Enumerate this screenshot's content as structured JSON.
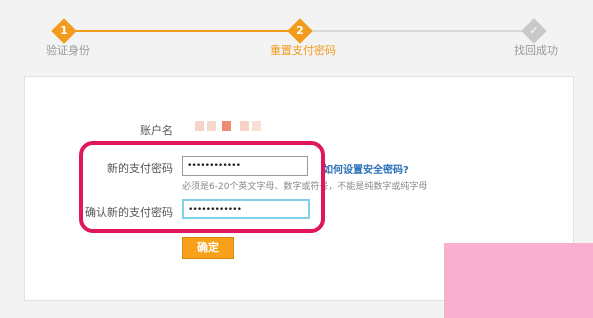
{
  "steps": [
    {
      "number": "1",
      "label": "验证身份",
      "state": "done"
    },
    {
      "number": "2",
      "label": "重置支付密码",
      "state": "active"
    },
    {
      "icon": "check-icon",
      "label": "找回成功",
      "state": "pending"
    }
  ],
  "form": {
    "account_label": "账户名",
    "new_password_label": "新的支付密码",
    "new_password_value": "••••••••••••",
    "help_link": "如何设置安全密码?",
    "hint": "必须是6-20个英文字母、数字或符号，不能是纯数字或纯字母",
    "confirm_password_label": "确认新的支付密码",
    "confirm_password_value": "••••••••••••",
    "submit_label": "确定"
  },
  "colors": {
    "accent": "#f29b1c",
    "highlight": "#e0175d",
    "link": "#2a6fb7",
    "focus_border": "#7fd0e8"
  }
}
